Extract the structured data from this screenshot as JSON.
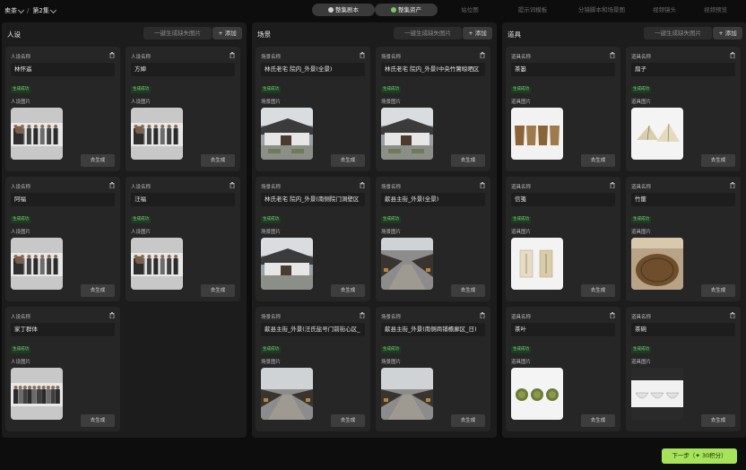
{
  "breadcrumb": {
    "project": "卖茶",
    "episode": "第2集"
  },
  "steps": [
    {
      "label": "整集剧本",
      "state": "active",
      "dot": "white"
    },
    {
      "label": "整集资产",
      "state": "active",
      "dot": "green"
    },
    {
      "label": "站位图",
      "state": "inactive"
    },
    {
      "label": "提示词模板",
      "state": "inactive"
    },
    {
      "label": "分镜脚本和场景图",
      "state": "inactive"
    },
    {
      "label": "视频镜头",
      "state": "inactive"
    },
    {
      "label": "视频预览",
      "state": "inactive"
    }
  ],
  "common": {
    "fill_missing": "一键生成缺失图片",
    "add": "+ 添加",
    "generate": "去生成",
    "status_done": "生成成功"
  },
  "columns": [
    {
      "title": "人设",
      "name_label": "人设名称",
      "image_label": "人设图片",
      "cards": [
        {
          "name": "林怀遥",
          "thumb": "people-lineup"
        },
        {
          "name": "方婶",
          "thumb": "people-lineup"
        },
        {
          "name": "阿福",
          "thumb": "people-lineup"
        },
        {
          "name": "汪福",
          "thumb": "people-lineup"
        },
        {
          "name": "家丁群体",
          "thumb": "group-photo"
        }
      ]
    },
    {
      "title": "场景",
      "name_label": "场景名称",
      "image_label": "场景图片",
      "cards": [
        {
          "name": "林氏老宅 院内_外景(全景)",
          "thumb": "courtyard"
        },
        {
          "name": "林氏老宅 院内_外景(中央竹篱晾晒区",
          "thumb": "courtyard-center"
        },
        {
          "name": "林氏老宅 院内_外景(南侧院门洞壁区",
          "thumb": "courtyard-wall"
        },
        {
          "name": "歙县主街_外景(全景)",
          "thumb": "street-aerial"
        },
        {
          "name": "歙县主街_外景(汪氏盐号门前街心区_",
          "thumb": "street"
        },
        {
          "name": "歙县主街_外景(南侧商铺檐廊区_日)",
          "thumb": "street"
        }
      ]
    },
    {
      "title": "道具",
      "name_label": "道具名称",
      "image_label": "道具图片",
      "cards": [
        {
          "name": "茶篓",
          "thumb": "baskets"
        },
        {
          "name": "扇子",
          "thumb": "fans"
        },
        {
          "name": "信笺",
          "thumb": "letters"
        },
        {
          "name": "竹篚",
          "thumb": "bamboo-basket"
        },
        {
          "name": "茶叶",
          "thumb": "tea-leaves"
        },
        {
          "name": "茶碗",
          "thumb": "tea-bowls"
        }
      ]
    }
  ],
  "next_button": "下一步（✦ 30积分）"
}
